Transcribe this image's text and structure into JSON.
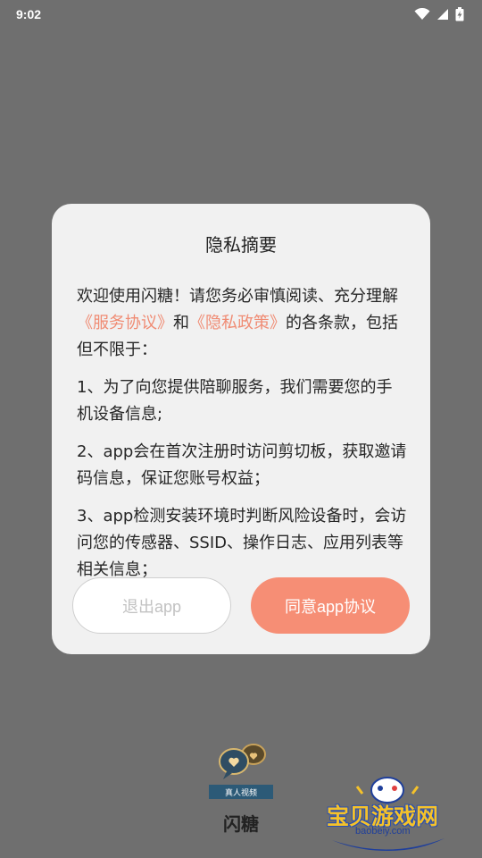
{
  "status_bar": {
    "time": "9:02"
  },
  "dialog": {
    "title": "隐私摘要",
    "intro_prefix": "欢迎使用闪糖！请您务必审慎阅读、充分理解",
    "link_service": "《服务协议》",
    "intro_and": "和",
    "link_privacy": "《隐私政策》",
    "intro_suffix": "的各条款，包括但不限于：",
    "item1": "1、为了向您提供陪聊服务，我们需要您的手机设备信息;",
    "item2": "2、app会在首次注册时访问剪切板，获取邀请码信息，保证您账号权益；",
    "item3": "3、app检测安装环境时判断风险设备时，会访问您的传感器、SSID、操作日志、应用列表等相关信息；",
    "exit_button": "退出app",
    "agree_button": "同意app协议"
  },
  "app": {
    "logo_tag": "真人视频",
    "name": "闪糖"
  },
  "watermark": {
    "title": "宝贝游戏网",
    "url": "baobeiy.com"
  },
  "colors": {
    "backdrop": "#6f6f6f",
    "dialog_bg": "#f1f1f1",
    "accent": "#f68e75",
    "link": "#f08b73"
  }
}
